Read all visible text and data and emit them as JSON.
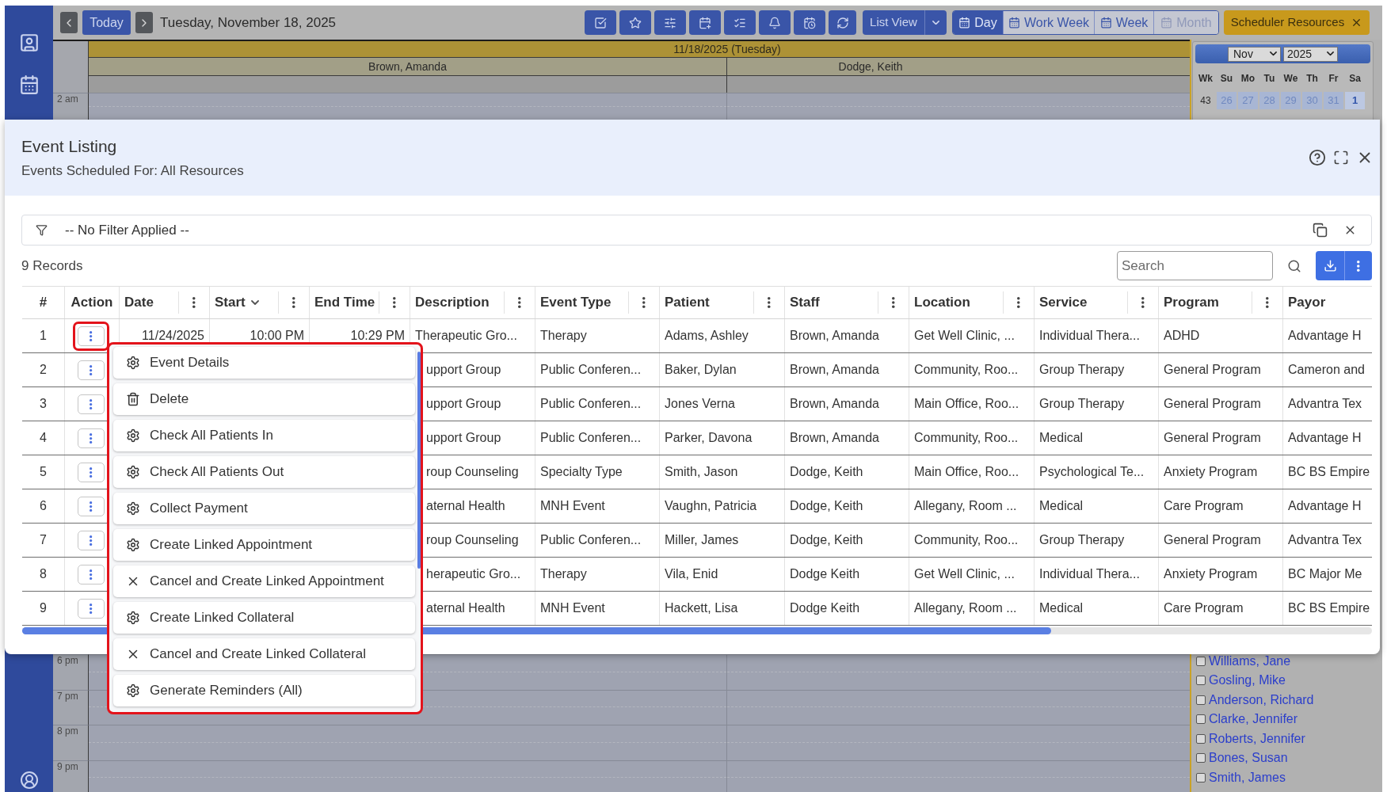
{
  "toolbar": {
    "today": "Today",
    "date": "Tuesday, November 18, 2025",
    "list_view": "List View",
    "views": [
      {
        "label": "Day",
        "selected": true,
        "disabled": false
      },
      {
        "label": "Work Week",
        "selected": false,
        "disabled": false
      },
      {
        "label": "Week",
        "selected": false,
        "disabled": false
      },
      {
        "label": "Month",
        "selected": false,
        "disabled": true
      }
    ],
    "resources_button": "Scheduler Resources"
  },
  "calendar": {
    "date_header": "11/18/2025 (Tuesday)",
    "resources": [
      "Brown, Amanda",
      "Dodge, Keith"
    ],
    "top_hours": [
      "2 am"
    ],
    "bottom_hours": [
      "6 pm",
      "7 pm",
      "8 pm",
      "9 pm"
    ]
  },
  "mini_calendar": {
    "month": "Nov",
    "year": "2025",
    "weekdays": [
      "Wk",
      "Su",
      "Mo",
      "Tu",
      "We",
      "Th",
      "Fr",
      "Sa"
    ],
    "week_number": "43",
    "days": [
      {
        "label": "26",
        "other_month": true
      },
      {
        "label": "27",
        "other_month": true
      },
      {
        "label": "28",
        "other_month": true
      },
      {
        "label": "29",
        "other_month": true
      },
      {
        "label": "30",
        "other_month": true
      },
      {
        "label": "31",
        "other_month": true
      },
      {
        "label": "1",
        "other_month": false
      }
    ]
  },
  "resource_list": [
    {
      "name": "Williams, Jane",
      "checked": false
    },
    {
      "name": "Gosling, Mike",
      "checked": false
    },
    {
      "name": "Anderson, Richard",
      "checked": false
    },
    {
      "name": "Clarke, Jennifer",
      "checked": false
    },
    {
      "name": "Roberts, Jennifer",
      "checked": false
    },
    {
      "name": "Bones, Susan",
      "checked": false
    },
    {
      "name": "Smith, James",
      "checked": false
    }
  ],
  "event_listing": {
    "title": "Event Listing",
    "subtitle": "Events Scheduled For: All Resources",
    "filter": "-- No Filter Applied --",
    "record_count": "9 Records",
    "search": {
      "placeholder": "Search"
    },
    "columns": [
      {
        "label": "#",
        "has_menu": false,
        "sorted": false
      },
      {
        "label": "Action",
        "has_menu": false,
        "sorted": false
      },
      {
        "label": "Date",
        "has_menu": true,
        "sorted": false
      },
      {
        "label": "Start",
        "has_menu": true,
        "sorted": true
      },
      {
        "label": "End Time",
        "has_menu": true,
        "sorted": false
      },
      {
        "label": "Description",
        "has_menu": true,
        "sorted": false
      },
      {
        "label": "Event Type",
        "has_menu": true,
        "sorted": false
      },
      {
        "label": "Patient",
        "has_menu": true,
        "sorted": false
      },
      {
        "label": "Staff",
        "has_menu": true,
        "sorted": false
      },
      {
        "label": "Location",
        "has_menu": true,
        "sorted": false
      },
      {
        "label": "Service",
        "has_menu": true,
        "sorted": false
      },
      {
        "label": "Program",
        "has_menu": true,
        "sorted": false
      },
      {
        "label": "Payor",
        "has_menu": false,
        "sorted": false
      }
    ],
    "rows": [
      {
        "number": "1",
        "menu_open": true,
        "date": "11/24/2025",
        "start_time": "10:00 PM",
        "end_time": "10:29 PM",
        "description": "Therapeutic Gro...",
        "event_type": "Therapy",
        "patient": "Adams, Ashley",
        "staff": "Brown, Amanda",
        "location": "Get Well Clinic, ...",
        "service": "Individual Thera...",
        "program": "ADHD",
        "payor": "Advantage H"
      },
      {
        "number": "2",
        "menu_open": false,
        "description": "upport Group",
        "event_type": "Public Conferen...",
        "patient": "Baker, Dylan",
        "staff": "Brown, Amanda",
        "location": "Community, Roo...",
        "service": "Group Therapy",
        "program": "General Program",
        "payor": "Cameron and"
      },
      {
        "number": "3",
        "menu_open": false,
        "description": "upport Group",
        "event_type": "Public Conferen...",
        "patient": "Jones Verna",
        "staff": "Brown, Amanda",
        "location": "Main Office, Roo...",
        "service": "Group Therapy",
        "program": "General Program",
        "payor": "Advantra Tex"
      },
      {
        "number": "4",
        "menu_open": false,
        "description": "upport Group",
        "event_type": "Public Conferen...",
        "patient": "Parker, Davona",
        "staff": "Brown, Amanda",
        "location": "Community, Roo...",
        "service": "Medical",
        "program": "General Program",
        "payor": "Advantage H"
      },
      {
        "number": "5",
        "menu_open": false,
        "description": "roup Counseling",
        "event_type": "Specialty Type",
        "patient": "Smith, Jason",
        "staff": "Dodge, Keith",
        "location": "Main Office, Roo...",
        "service": "Psychological Te...",
        "program": "Anxiety Program",
        "payor": "BC BS Empire"
      },
      {
        "number": "6",
        "menu_open": false,
        "description": "aternal Health",
        "event_type": "MNH Event",
        "patient": "Vaughn, Patricia",
        "staff": "Dodge, Keith",
        "location": "Allegany, Room ...",
        "service": "Medical",
        "program": "Care Program",
        "payor": "Advantage H"
      },
      {
        "number": "7",
        "menu_open": false,
        "description": "roup Counseling",
        "event_type": "Public Conferen...",
        "patient": "Miller, James",
        "staff": "Dodge, Keith",
        "location": "Community, Roo...",
        "service": "Group Therapy",
        "program": "General Program",
        "payor": "Advantra Tex"
      },
      {
        "number": "8",
        "menu_open": false,
        "description": "herapeutic Gro...",
        "event_type": "Therapy",
        "patient": "Vila, Enid",
        "staff": "Dodge Keith",
        "location": "Get Well Clinic, ...",
        "service": "Individual Thera...",
        "program": "Anxiety Program",
        "payor": "BC Major Me"
      },
      {
        "number": "9",
        "menu_open": false,
        "description": "aternal Health",
        "event_type": "MNH Event",
        "patient": "Hackett, Lisa",
        "staff": "Dodge Keith",
        "location": "Allegany, Room ...",
        "service": "Medical",
        "program": "Care Program",
        "payor": "BC BS Empire"
      }
    ],
    "action_menu": {
      "items": [
        {
          "kind": "settings",
          "label": "Event Details"
        },
        {
          "kind": "delete",
          "label": "Delete"
        },
        {
          "kind": "settings",
          "label": "Check All Patients In"
        },
        {
          "kind": "settings",
          "label": "Check All Patients Out"
        },
        {
          "kind": "settings",
          "label": "Collect Payment"
        },
        {
          "kind": "settings",
          "label": "Create Linked Appointment"
        },
        {
          "kind": "cancel",
          "label": "Cancel and Create Linked Appointment"
        },
        {
          "kind": "settings",
          "label": "Create Linked Collateral"
        },
        {
          "kind": "cancel",
          "label": "Cancel and Create Linked Collateral"
        },
        {
          "kind": "settings",
          "label": "Generate Reminders (All)"
        }
      ]
    }
  }
}
